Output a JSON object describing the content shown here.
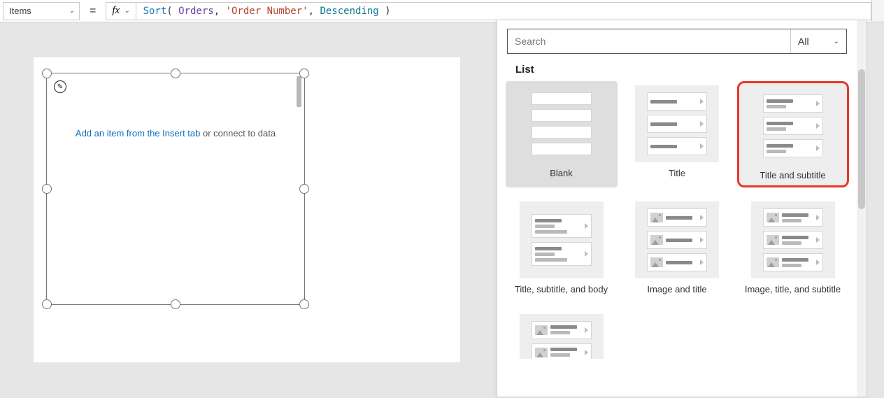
{
  "formula_bar": {
    "property": "Items",
    "equals": "=",
    "fx_label": "fx",
    "tokens": {
      "fn": "Sort",
      "open": "( ",
      "ds": "Orders",
      "c1": ", ",
      "str": "'Order Number'",
      "c2": ", ",
      "kw": "Descending",
      "close": " )"
    }
  },
  "gallery_placeholder": {
    "link": "Add an item from the Insert tab",
    "rest": " or connect to data"
  },
  "layout_panel": {
    "search_placeholder": "Search",
    "filter_label": "All",
    "section": "List",
    "tiles": [
      {
        "label": "Blank"
      },
      {
        "label": "Title"
      },
      {
        "label": "Title and subtitle"
      },
      {
        "label": "Title, subtitle, and body"
      },
      {
        "label": "Image and title"
      },
      {
        "label": "Image, title, and subtitle"
      }
    ]
  }
}
